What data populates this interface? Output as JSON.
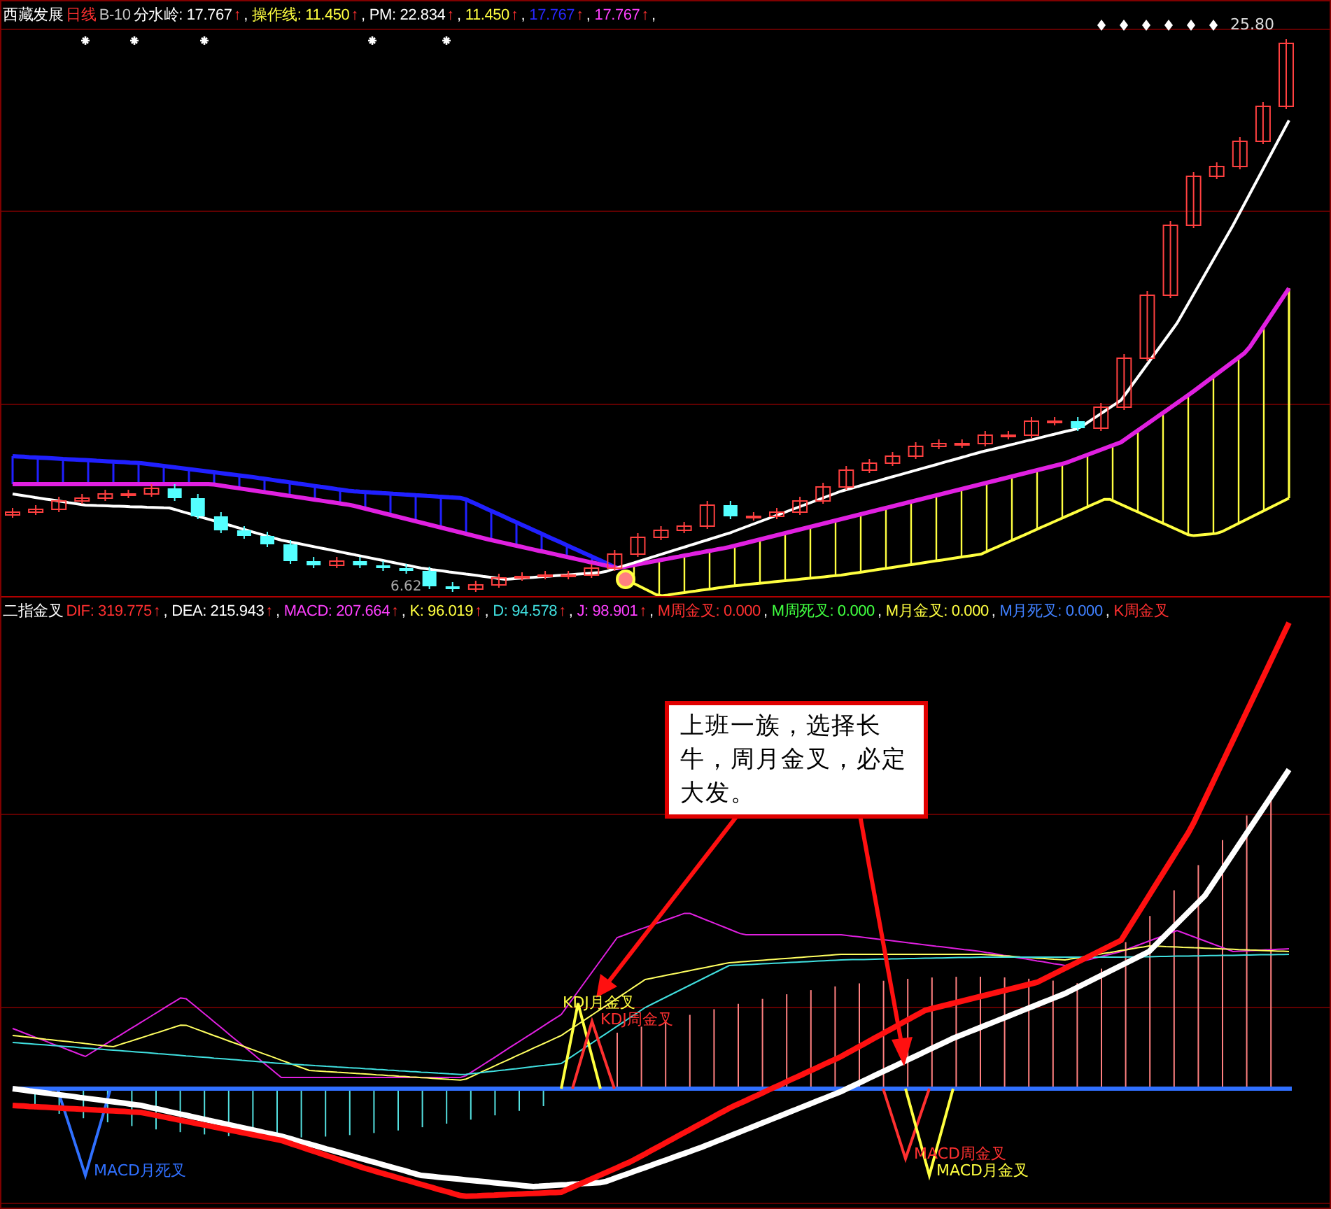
{
  "price_panel": {
    "legend": [
      {
        "text": "西藏发展",
        "color": "#ffffff"
      },
      {
        "text": "日线",
        "color": "#ff3030"
      },
      {
        "text": "B-10",
        "color": "#c0c0c0"
      },
      {
        "text": "分水岭: 17.767",
        "color": "#ffffff",
        "arrow": "↑",
        "sep": ","
      },
      {
        "text": "操作线: 11.450",
        "color": "#ffff40",
        "arrow": "↑",
        "sep": ","
      },
      {
        "text": "PM: 22.834",
        "color": "#ffffff",
        "arrow": "↑",
        "sep": ","
      },
      {
        "text": "11.450",
        "color": "#ffff40",
        "arrow": "↑",
        "sep": ","
      },
      {
        "text": "17.767",
        "color": "#2828ff",
        "arrow": "↑",
        "sep": ","
      },
      {
        "text": "17.767",
        "color": "#ff40ff",
        "arrow": "↑",
        "sep": ","
      }
    ],
    "high_label": "25.80",
    "low_label": "6.62"
  },
  "indicator_panel": {
    "legend": [
      {
        "text": "二指金叉",
        "color": "#ffffff"
      },
      {
        "text": "DIF: 319.775",
        "color": "#ff3030",
        "arrow": "↑",
        "sep": ","
      },
      {
        "text": "DEA: 215.943",
        "color": "#ffffff",
        "arrow": "↑",
        "sep": ","
      },
      {
        "text": "MACD: 207.664",
        "color": "#ff40ff",
        "arrow": "↑",
        "sep": ","
      },
      {
        "text": "K: 96.019",
        "color": "#ffff40",
        "arrow": "↑",
        "sep": ","
      },
      {
        "text": "D: 94.578",
        "color": "#40e0e0",
        "arrow": "↑",
        "sep": ","
      },
      {
        "text": "J: 98.901",
        "color": "#ff40ff",
        "arrow": "↑",
        "sep": ","
      },
      {
        "text": "M周金叉: 0.000",
        "color": "#ff3030",
        "sep": ","
      },
      {
        "text": "M周死叉: 0.000",
        "color": "#40ff40",
        "sep": ","
      },
      {
        "text": "M月金叉: 0.000",
        "color": "#ffff40",
        "sep": ","
      },
      {
        "text": "M月死叉: 0.000",
        "color": "#4080ff",
        "sep": ","
      },
      {
        "text": "K周金叉",
        "color": "#ff3030"
      }
    ],
    "signals": [
      {
        "text": "KDJ月金叉",
        "color": "#ffff40"
      },
      {
        "text": "KDJ周金叉",
        "color": "#ff3030"
      },
      {
        "text": "MACD周金叉",
        "color": "#ff3030"
      },
      {
        "text": "MACD月金叉",
        "color": "#ffff40"
      },
      {
        "text": "MACD月死叉",
        "color": "#3070ff"
      }
    ],
    "callout": "上班一族，选择长牛，周月金叉，必定大发。"
  }
}
